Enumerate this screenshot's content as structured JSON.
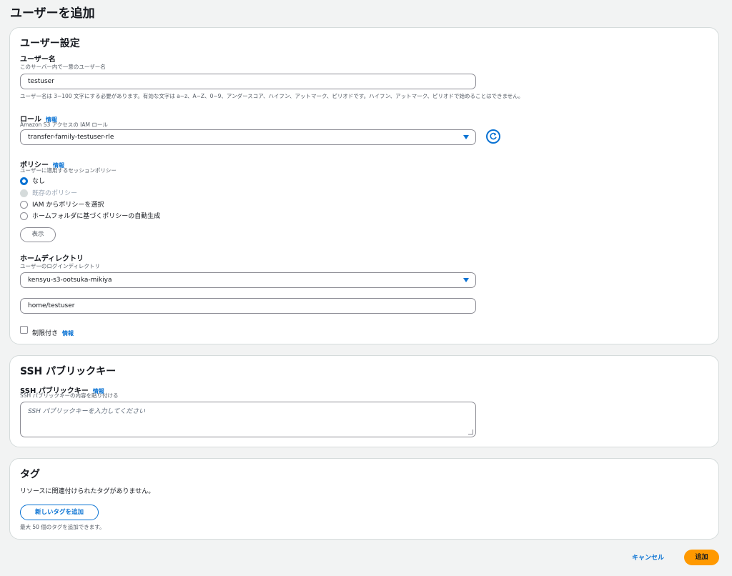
{
  "page": {
    "title": "ユーザーを追加"
  },
  "user_settings": {
    "section_title": "ユーザー設定",
    "username": {
      "label": "ユーザー名",
      "description": "このサーバー内で一意のユーザー名",
      "value": "testuser",
      "constraint": "ユーザー名は 3~100 文字にする必要があります。有効な文字は a~z、A~Z、0~9、アンダースコア、ハイフン、アットマーク、ピリオドです。ハイフン、アットマーク、ピリオドで始めることはできません。"
    },
    "role": {
      "label": "ロール",
      "info": "情報",
      "description": "Amazon S3 アクセスの IAM ロール",
      "value": "transfer-family-testuser-rle"
    },
    "policy": {
      "label": "ポリシー",
      "info": "情報",
      "description": "ユーザーに適用するセッションポリシー",
      "options": [
        {
          "label": "なし",
          "state": "checked"
        },
        {
          "label": "既存のポリシー",
          "state": "disabled"
        },
        {
          "label": "IAM からポリシーを選択",
          "state": "unchecked"
        },
        {
          "label": "ホームフォルダに基づくポリシーの自動生成",
          "state": "unchecked"
        }
      ],
      "view_button": "表示"
    },
    "home_directory": {
      "label": "ホームディレクトリ",
      "description": "ユーザーのログインディレクトリ",
      "bucket_value": "kensyu-s3-ootsuka-mikiya",
      "path_value": "home/testuser",
      "restricted_label": "制限付き",
      "info": "情報"
    }
  },
  "ssh": {
    "section_title": "SSH パブリックキー",
    "label": "SSH パブリックキー",
    "info": "情報",
    "description": "SSH パブリックキーの内容を貼り付ける",
    "placeholder": "SSH パブリックキーを入力してください"
  },
  "tags": {
    "section_title": "タグ",
    "empty_text": "リソースに関連付けられたタグがありません。",
    "add_button": "新しいタグを追加",
    "limit_text": "最大 50 個のタグを追加できます。"
  },
  "footer": {
    "cancel": "キャンセル",
    "submit": "追加"
  },
  "colors": {
    "link_blue": "#0972d3",
    "primary_orange": "#ff9900",
    "border": "#d5dbdb"
  },
  "icons": {
    "refresh": "refresh-icon",
    "dropdown": "chevron-down-icon"
  }
}
